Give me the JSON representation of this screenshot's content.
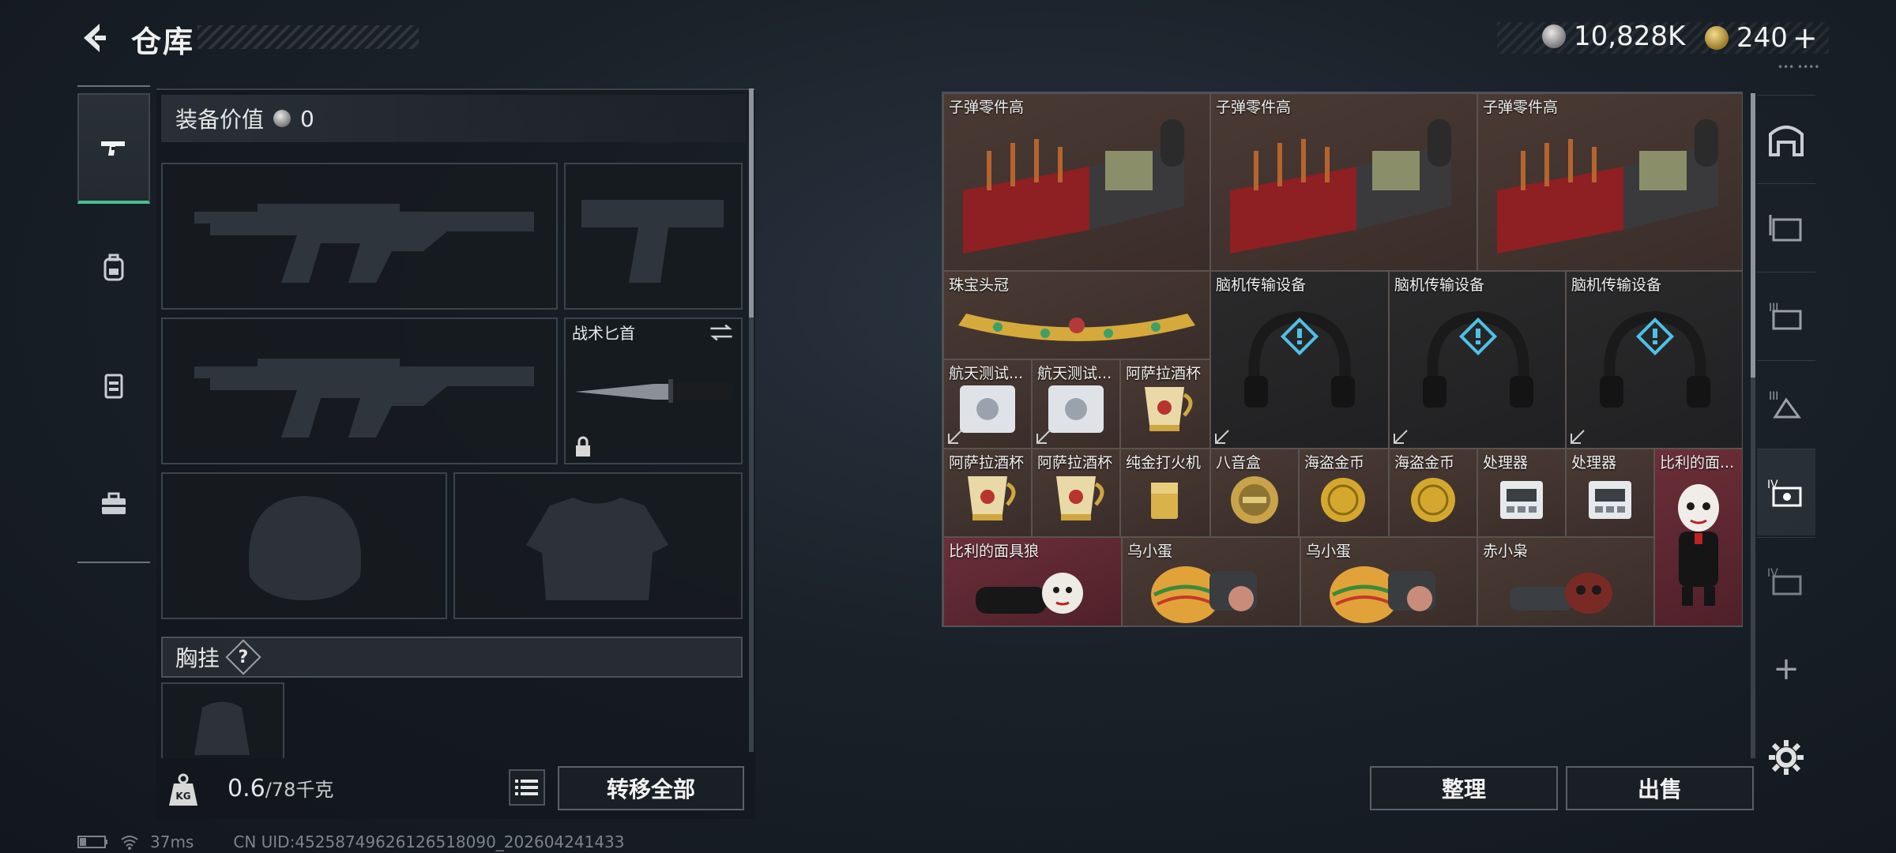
{
  "header": {
    "title": "仓库",
    "currency_silver": "10,828K",
    "currency_gold": "240",
    "currency_gold_plus": "+",
    "top_mini_text": "••• ••••"
  },
  "left_tabs": [
    {
      "name": "weapons",
      "active": true
    },
    {
      "name": "backpack",
      "active": false
    },
    {
      "name": "vest",
      "active": false
    },
    {
      "name": "case",
      "active": false
    }
  ],
  "equipment": {
    "value_label": "装备价值",
    "value": "0",
    "knife_label": "战术匕首",
    "chest_label": "胸挂",
    "chest_badge": "?",
    "weight_current": "0.6",
    "weight_max": "/78千克",
    "transfer_all": "转移全部"
  },
  "storage_items": [
    {
      "name": "子弹零件高"
    },
    {
      "name": "子弹零件高"
    },
    {
      "name": "子弹零件高"
    },
    {
      "name": "珠宝头冠"
    },
    {
      "name": "脑机传输设备"
    },
    {
      "name": "脑机传输设备"
    },
    {
      "name": "脑机传输设备"
    },
    {
      "name": "航天测试..."
    },
    {
      "name": "航天测试..."
    },
    {
      "name": "阿萨拉酒杯"
    },
    {
      "name": "阿萨拉酒杯"
    },
    {
      "name": "阿萨拉酒杯"
    },
    {
      "name": "纯金打火机"
    },
    {
      "name": "八音盒"
    },
    {
      "name": "海盗金币"
    },
    {
      "name": "海盗金币"
    },
    {
      "name": "处理器"
    },
    {
      "name": "处理器"
    },
    {
      "name": "比利的面..."
    },
    {
      "name": "比利的面具狼"
    },
    {
      "name": "乌小蛋"
    },
    {
      "name": "乌小蛋"
    },
    {
      "name": "赤小枭"
    }
  ],
  "storage_actions": {
    "organize": "整理",
    "sell": "出售",
    "add": "+"
  },
  "status": {
    "ping": "37ms",
    "uid": "CN UID:452587496261265180​90_202604241433"
  },
  "colors": {
    "accent_green": "#49c08e",
    "cell_brown": "#4a3a34",
    "cell_dark": "#2b2a2b",
    "cell_red": "#6b2f39"
  }
}
